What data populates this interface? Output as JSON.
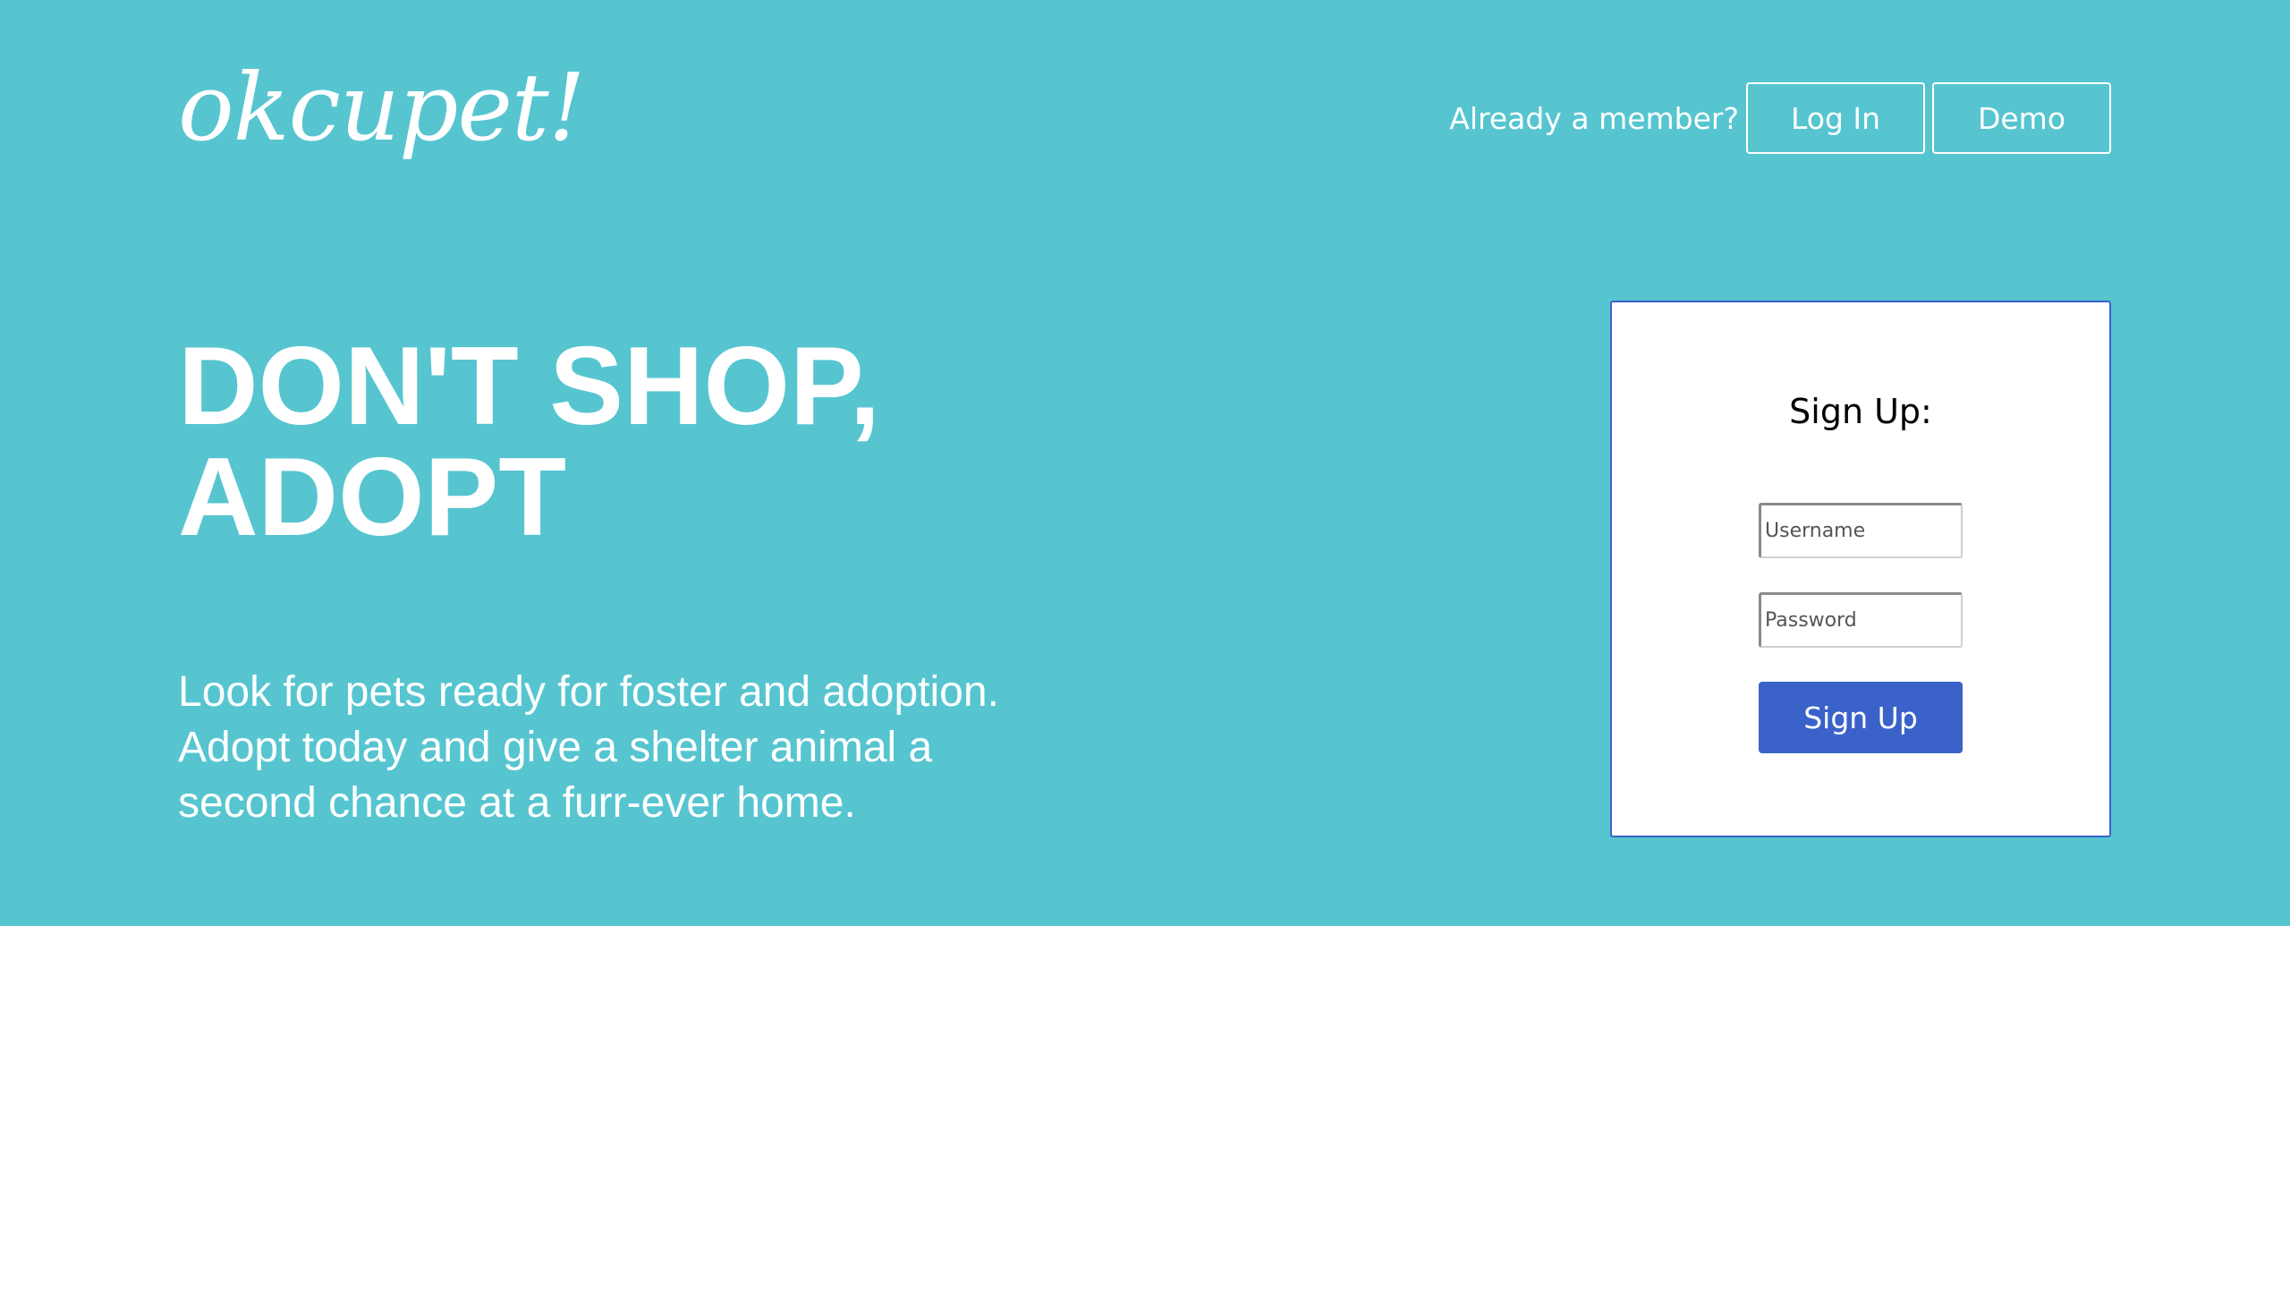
{
  "header": {
    "logo_text": "okcupet!",
    "member_prompt": "Already a member?",
    "login_label": "Log In",
    "demo_label": "Demo"
  },
  "hero": {
    "headline_line1": "DON'T SHOP,",
    "headline_line2": "ADOPT",
    "tagline": "Look for pets ready for foster and adoption. Adopt today and give a shelter animal a second chance at a furr-ever home."
  },
  "signup": {
    "title": "Sign Up:",
    "username_placeholder": "Username",
    "password_placeholder": "Password",
    "submit_label": "Sign Up"
  },
  "colors": {
    "hero_background": "#56c5d0",
    "accent": "#3a62c9",
    "text_light": "#ffffff"
  }
}
